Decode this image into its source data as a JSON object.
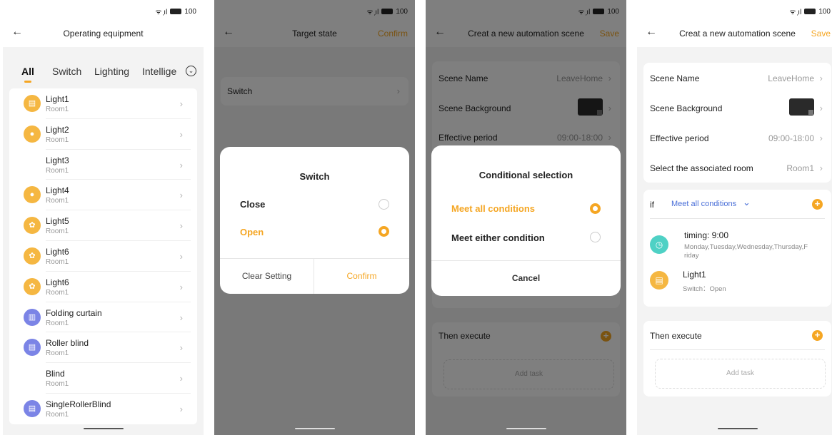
{
  "status": {
    "signal": "ᯤ ᷊ıl",
    "battery": "100"
  },
  "s1": {
    "title": "Operating equipment",
    "tabs": [
      "All",
      "Switch",
      "Lighting",
      "Intellige"
    ],
    "devices": [
      {
        "name": "Light1",
        "room": "Room1",
        "icon": "light-square-icon",
        "color": "#f5b742"
      },
      {
        "name": "Light2",
        "room": "Room1",
        "icon": "bulb-icon",
        "color": "#f5b742"
      },
      {
        "name": "Light3",
        "room": "Room1",
        "icon": "",
        "color": ""
      },
      {
        "name": "Light4",
        "room": "Room1",
        "icon": "bulb-icon",
        "color": "#f5b742"
      },
      {
        "name": "Light5",
        "room": "Room1",
        "icon": "rgb-light-icon",
        "color": "#f5b742"
      },
      {
        "name": "Light6",
        "room": "Room1",
        "icon": "rgb-light-icon",
        "color": "#f5b742"
      },
      {
        "name": "Light6",
        "room": "Room1",
        "icon": "rgb-light-icon",
        "color": "#f5b742"
      },
      {
        "name": "Folding curtain",
        "room": "Room1",
        "icon": "curtain-icon",
        "color": "#7b84e6"
      },
      {
        "name": "Roller blind",
        "room": "Room1",
        "icon": "blind-icon",
        "color": "#7b84e6"
      },
      {
        "name": "Blind",
        "room": "Room1",
        "icon": "",
        "color": ""
      },
      {
        "name": "SingleRollerBlind",
        "room": "Room1",
        "icon": "blind-icon",
        "color": "#7b84e6"
      }
    ]
  },
  "s2": {
    "title": "Target state",
    "action": "Confirm",
    "row": "Switch",
    "dialog": {
      "title": "Switch",
      "options": [
        {
          "label": "Close",
          "selected": false
        },
        {
          "label": "Open",
          "selected": true
        }
      ],
      "clear": "Clear Setting",
      "confirm": "Confirm"
    }
  },
  "scene": {
    "title": "Creat a new automation scene",
    "action": "Save",
    "scene_name_label": "Scene Name",
    "scene_name_value": "LeaveHome",
    "bg_label": "Scene Background",
    "period_label": "Effective period",
    "period_value": "09:00-18:00",
    "room_label": "Select the associated room",
    "room_value": "Room1",
    "if_label": "if",
    "condition_mode": "Meet all conditions",
    "conditions": [
      {
        "title": "timing: 9:00",
        "detail": "Monday,Tuesday,Wednesday,Thursday,Friday",
        "icon": "clock-icon",
        "color": "#4fd1c5"
      },
      {
        "title": "Light1",
        "detail": "Switch：Open",
        "icon": "light-square-icon",
        "color": "#f5b742"
      }
    ],
    "then_label": "Then execute",
    "add_task": "Add task"
  },
  "s3dialog": {
    "title": "Conditional selection",
    "options": [
      {
        "label": "Meet all conditions",
        "selected": true
      },
      {
        "label": "Meet either condition",
        "selected": false
      }
    ],
    "cancel": "Cancel"
  }
}
